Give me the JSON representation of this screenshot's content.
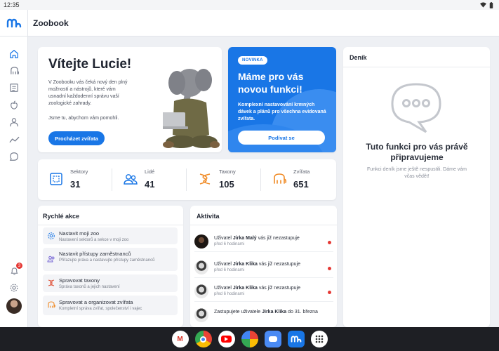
{
  "status_bar": {
    "time": "12:35"
  },
  "app": {
    "title": "Zoobook"
  },
  "sidebar": {
    "items": [
      "home-icon",
      "elephant-icon",
      "news-icon",
      "apple-icon",
      "user-icon",
      "chart-icon",
      "chat-icon"
    ],
    "notification_count": "3"
  },
  "welcome": {
    "title": "Vítejte Lucie!",
    "description": "V Zoobooku vás čeká nový den plný možností a nástrojů, které vám usnadní každodenní správu vaší zoologické zahrady.",
    "help": "Jsme tu, abychom vám pomohli.",
    "button": "Procházet zvířata"
  },
  "news": {
    "tag": "NOVINKA",
    "title": "Máme pro vás novou funkci!",
    "description": "Komplexní nastavování krmných dávek a plánů pro všechna evidovaná zvířata.",
    "button": "Podívat se"
  },
  "stats": [
    {
      "label": "Sektory",
      "value": "31",
      "color": "#1976e6"
    },
    {
      "label": "Lidé",
      "value": "41",
      "color": "#1976e6"
    },
    {
      "label": "Taxony",
      "value": "105",
      "color": "#f08a24"
    },
    {
      "label": "Zvířata",
      "value": "651",
      "color": "#f08a24"
    }
  ],
  "quick_actions": {
    "title": "Rychlé akce",
    "items": [
      {
        "name": "Nastavit moji zoo",
        "desc": "Nastavení sektorů a sekce v moji zoo"
      },
      {
        "name": "Nastavit přístupy zaměstnanců",
        "desc": "Přiřazujte práva a nastavujte přístupy zaměstnanců"
      },
      {
        "name": "Spravovat taxony",
        "desc": "Správa taxonů a jejich nastavení"
      },
      {
        "name": "Spravovat a organizovat zvířata",
        "desc": "Kompletní správa zvířat, společenství i vajec"
      }
    ]
  },
  "activity": {
    "title": "Aktivita",
    "items": [
      {
        "prefix": "Uživatel ",
        "name": "Jirka Malý",
        "suffix": " vás již nezastupuje",
        "time": "před 6 hodinami"
      },
      {
        "prefix": "Uživatel ",
        "name": "Jirka Klika",
        "suffix": " vás již nezastupuje",
        "time": "před 6 hodinami"
      },
      {
        "prefix": "Uživatel ",
        "name": "Jirka Klika",
        "suffix": " vás již nezastupuje",
        "time": "před 6 hodinami"
      },
      {
        "prefix": "Zastupujete uživatele ",
        "name": "Jirka Klika",
        "suffix": " do 31. března",
        "time": ""
      }
    ]
  },
  "diary": {
    "title": "Deník",
    "heading": "Tuto funkci pro vás právě připravujeme",
    "description": "Funkci deník jsme ještě nespustili. Dáme vám včas vědět!"
  },
  "taskbar": [
    "gmail-icon",
    "chrome-icon",
    "youtube-icon",
    "photos-icon",
    "messages-icon",
    "zoobook-icon",
    "launcher-icon"
  ]
}
